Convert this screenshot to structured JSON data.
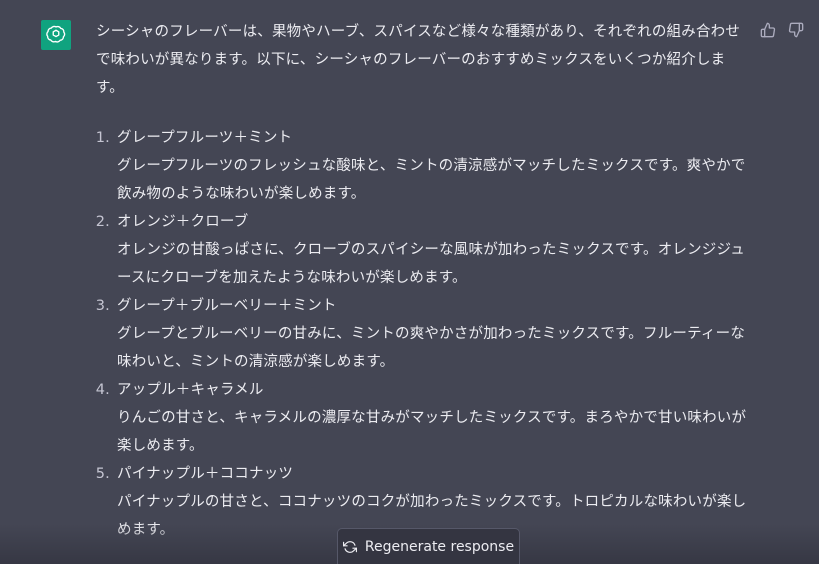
{
  "message": {
    "intro": "シーシャのフレーバーは、果物やハーブ、スパイスなど様々な種類があり、それぞれの組み合わせで味わいが異なります。以下に、シーシャのフレーバーのおすすめミックスをいくつか紹介します。",
    "items": [
      {
        "number": "1.",
        "title": "グレープフルーツ＋ミント",
        "description": "グレープフルーツのフレッシュな酸味と、ミントの清涼感がマッチしたミックスです。爽やかで飲み物のような味わいが楽しめます。"
      },
      {
        "number": "2.",
        "title": "オレンジ＋クローブ",
        "description": "オレンジの甘酸っぱさに、クローブのスパイシーな風味が加わったミックスです。オレンジジュースにクローブを加えたような味わいが楽しめます。"
      },
      {
        "number": "3.",
        "title": "グレープ＋ブルーベリー＋ミント",
        "description": "グレープとブルーベリーの甘みに、ミントの爽やかさが加わったミックスです。フルーティーな味わいと、ミントの清涼感が楽しめます。"
      },
      {
        "number": "4.",
        "title": "アップル＋キャラメル",
        "description": "りんごの甘さと、キャラメルの濃厚な甘みがマッチしたミックスです。まろやかで甘い味わいが楽しめます。"
      },
      {
        "number": "5.",
        "title": "パイナップル＋ココナッツ",
        "description": "パイナップルの甘さと、ココナッツのコクが加わったミックスです。トロピカルな味わいが楽しめます。"
      }
    ]
  },
  "regenerate_label": "Regenerate response",
  "icons": {
    "avatar": "openai-logo-icon",
    "thumbs_up": "thumbs-up-icon",
    "thumbs_down": "thumbs-down-icon",
    "regenerate": "refresh-icon"
  },
  "colors": {
    "background": "#444654",
    "accent": "#10a37f",
    "text": "#ececf1"
  }
}
